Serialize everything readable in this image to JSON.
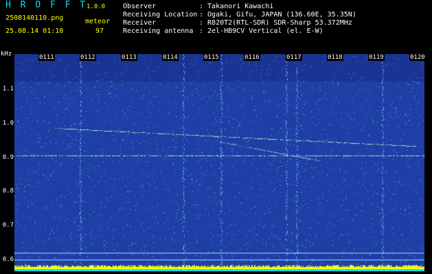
{
  "app": {
    "logo": "H R O F F T",
    "version": "1.0.0",
    "filename": "2508140110.png",
    "datetime": "25.08.14 01:10",
    "detection_type": "meteor",
    "detection_count": "97"
  },
  "info": [
    {
      "label": "Observer",
      "value": ": Takanori Kawachi"
    },
    {
      "label": "Receiving Location",
      "value": ": Ogaki, Gifu, JAPAN (136.60E, 35.35N)"
    },
    {
      "label": "Receiver",
      "value": ": R820T2(RTL-SDR) SDR-Sharp 53.372MHz"
    },
    {
      "label": "Receiving antenna",
      "value": ": 2el-HB9CV Vertical (el. E-W)"
    }
  ],
  "axes": {
    "y_unit": "kHz",
    "y_ticks": [
      "1.1",
      "1.0",
      "0.9",
      "0.8",
      "0.7",
      "0.6"
    ],
    "x_ticks": [
      "0111",
      "0112",
      "0113",
      "0114",
      "0115",
      "0116",
      "0117",
      "0118",
      "0119",
      "0120"
    ]
  },
  "colors": {
    "background": "#000000",
    "spectrogram_base": "#1f3fa6",
    "accent_text": "#ffff00",
    "logo": "#00e5ff"
  }
}
